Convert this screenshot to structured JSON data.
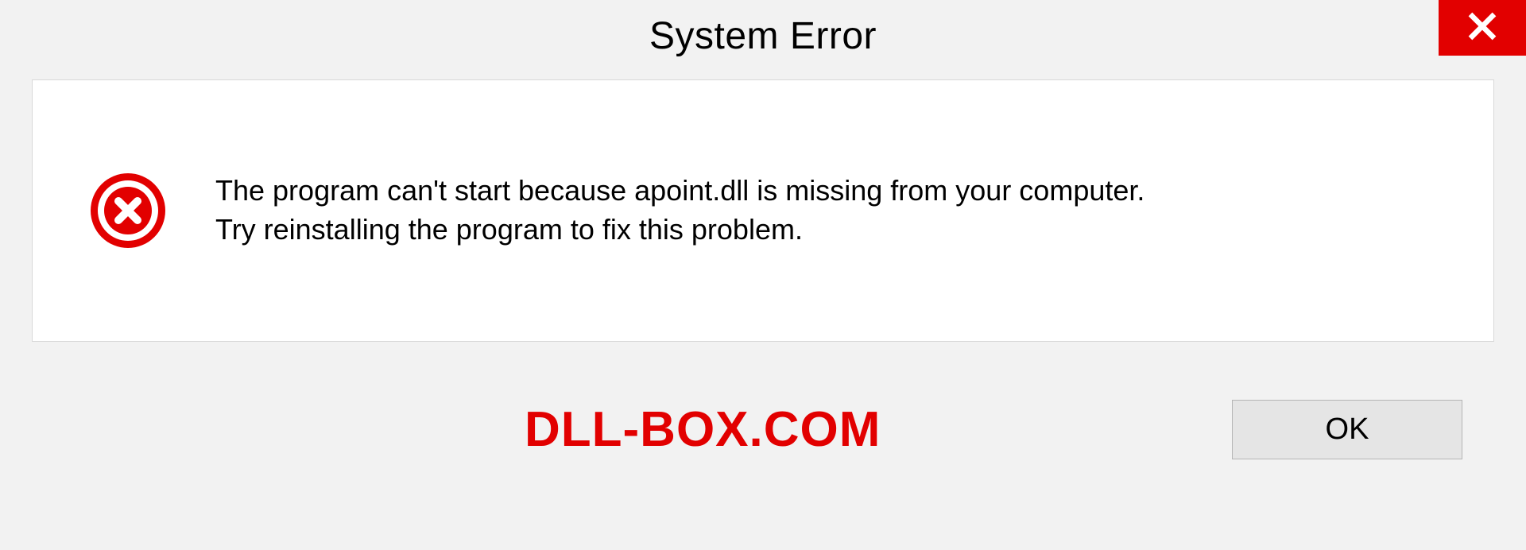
{
  "dialog": {
    "title": "System Error",
    "message_line1": "The program can't start because apoint.dll is missing from your computer.",
    "message_line2": "Try reinstalling the program to fix this problem.",
    "ok_label": "OK"
  },
  "watermark": "DLL-BOX.COM",
  "colors": {
    "accent_red": "#e20000",
    "bg": "#f2f2f2",
    "panel_bg": "#ffffff",
    "button_bg": "#e5e5e5"
  }
}
